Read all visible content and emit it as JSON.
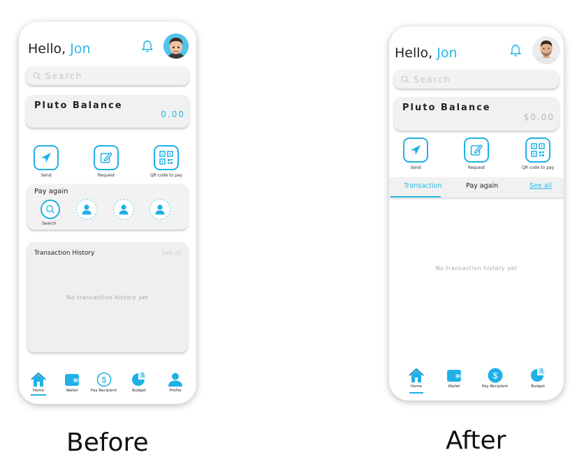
{
  "before": {
    "greeting": "Hello,",
    "user_name": "Jon",
    "search_placeholder": "Search",
    "balance": {
      "title": "Pluto Balance",
      "value": "0.00"
    },
    "actions": [
      {
        "label": "Send",
        "icon": "send-icon"
      },
      {
        "label": "Request",
        "icon": "edit-icon"
      },
      {
        "label": "QR code to pay",
        "icon": "qr-code-icon"
      }
    ],
    "pay_again": {
      "title": "Pay again",
      "search_label": "Search"
    },
    "history": {
      "title": "Transaction History",
      "see_all": "See all",
      "empty": "No transaction history yet"
    },
    "nav": [
      {
        "label": "Home",
        "icon": "home-icon",
        "active": true
      },
      {
        "label": "Wallet",
        "icon": "wallet-icon"
      },
      {
        "label": "Pay Recipient",
        "icon": "dollar-icon"
      },
      {
        "label": "Budget",
        "icon": "budget-icon"
      },
      {
        "label": "Profile",
        "icon": "person-icon"
      }
    ]
  },
  "after": {
    "greeting": "Hello,",
    "user_name": "Jon",
    "search_placeholder": "Search",
    "balance": {
      "title": "Pluto Balance",
      "value": "$0.00"
    },
    "actions": [
      {
        "label": "Send",
        "icon": "send-icon"
      },
      {
        "label": "Request",
        "icon": "edit-icon"
      },
      {
        "label": "QR code to pay",
        "icon": "qr-code-icon"
      }
    ],
    "tabs": {
      "transaction": "Transaction",
      "pay_again": "Pay again",
      "see_all": "See all"
    },
    "empty": "No transaction history yet",
    "nav": [
      {
        "label": "Home",
        "icon": "home-icon",
        "active": true
      },
      {
        "label": "Wallet",
        "icon": "wallet-icon"
      },
      {
        "label": "Pay Recipient",
        "icon": "dollar-icon"
      },
      {
        "label": "Budget",
        "icon": "budget-icon"
      }
    ]
  },
  "captions": {
    "before": "Before",
    "after": "After"
  },
  "colors": {
    "accent": "#1fb0e6",
    "name": "#2ab7e6",
    "zero_balance_before": "#2ab7e6",
    "zero_balance_after": "#b9b9b9",
    "muted_text": "#a6a6a6"
  }
}
